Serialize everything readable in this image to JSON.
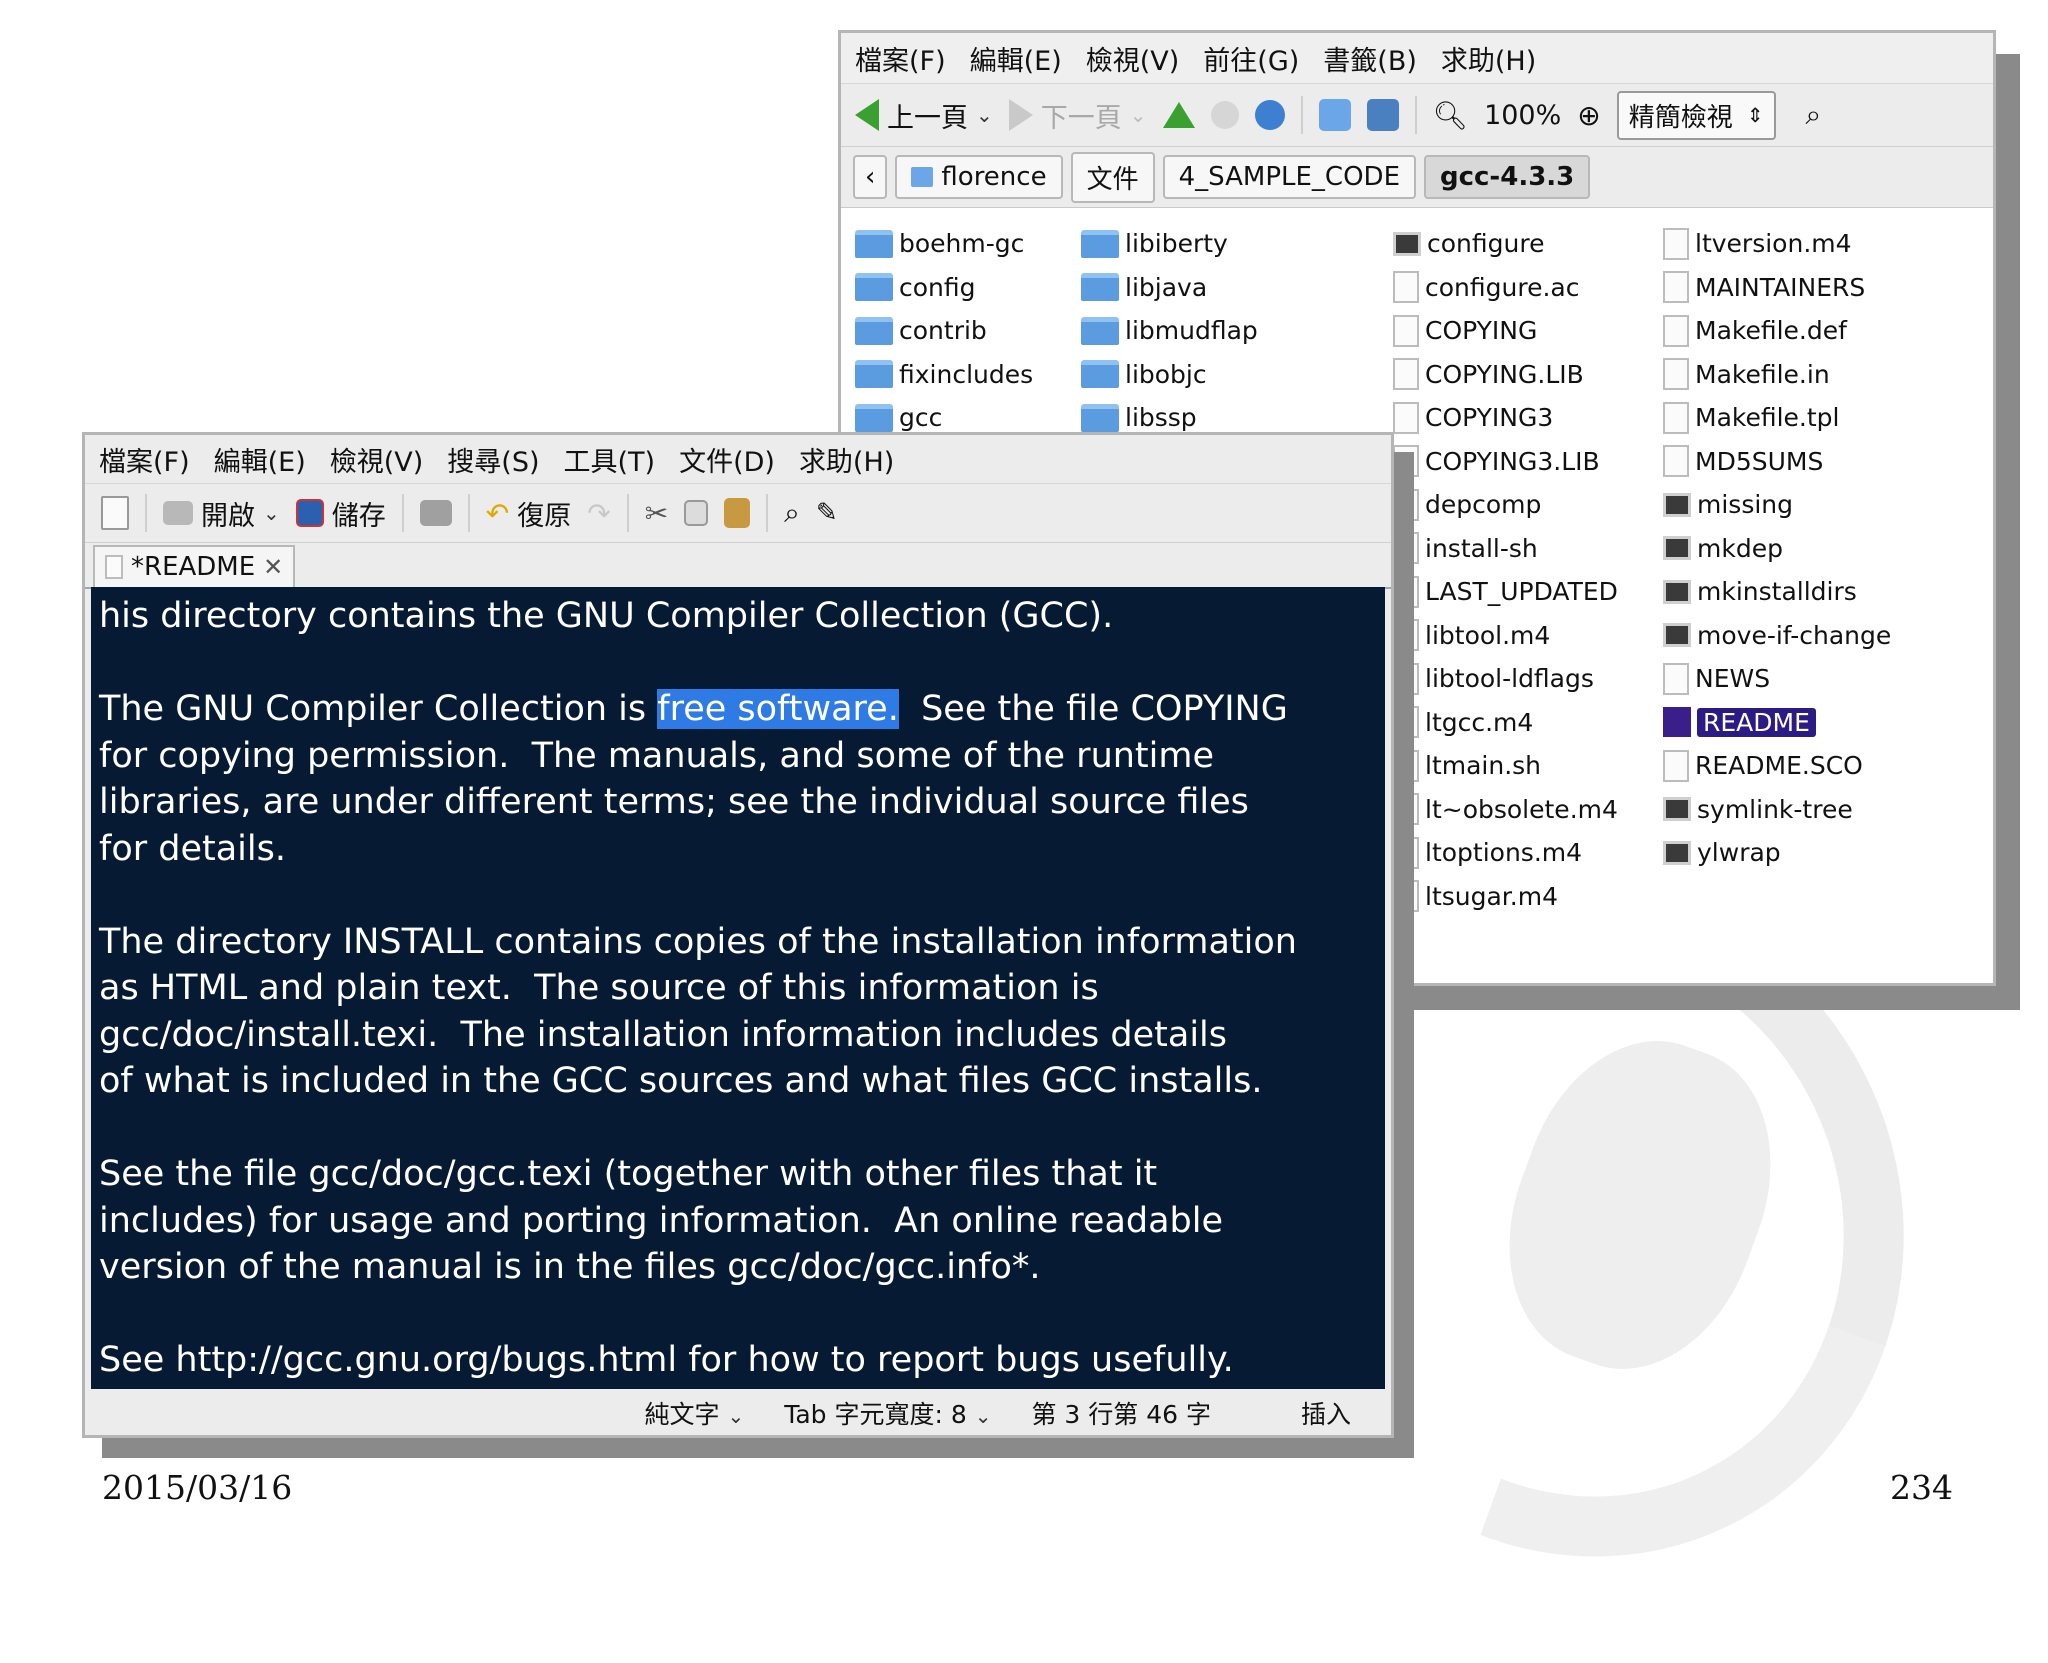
{
  "file_manager": {
    "menu": [
      "檔案(F)",
      "編輯(E)",
      "檢視(V)",
      "前往(G)",
      "書籤(B)",
      "求助(H)"
    ],
    "toolbar": {
      "back_label": "上一頁",
      "forward_label": "下一頁",
      "zoom_level": "100%",
      "view_mode": "精簡檢視"
    },
    "breadcrumb": [
      "florence",
      "文件",
      "4_SAMPLE_CODE",
      "gcc-4.3.3"
    ],
    "columns": [
      [
        {
          "name": "boehm-gc",
          "icon": "folder-icon"
        },
        {
          "name": "config",
          "icon": "folder-icon"
        },
        {
          "name": "contrib",
          "icon": "folder-icon"
        },
        {
          "name": "fixincludes",
          "icon": "folder-icon"
        },
        {
          "name": "gcc",
          "icon": "folder-icon"
        }
      ],
      [
        {
          "name": "libiberty",
          "icon": "folder-icon"
        },
        {
          "name": "libjava",
          "icon": "folder-icon"
        },
        {
          "name": "libmudflap",
          "icon": "folder-icon"
        },
        {
          "name": "libobjc",
          "icon": "folder-icon"
        },
        {
          "name": "libssp",
          "icon": "folder-icon"
        }
      ],
      [
        {
          "name": "configure",
          "icon": "script-icon"
        },
        {
          "name": "configure.ac",
          "icon": "document-icon"
        },
        {
          "name": "COPYING",
          "icon": "document-icon"
        },
        {
          "name": "COPYING.LIB",
          "icon": "document-icon"
        },
        {
          "name": "COPYING3",
          "icon": "document-icon"
        },
        {
          "name": "COPYING3.LIB",
          "icon": "document-icon"
        },
        {
          "name": "depcomp",
          "icon": "document-icon"
        },
        {
          "name": "install-sh",
          "icon": "document-icon"
        },
        {
          "name": "LAST_UPDATED",
          "icon": "document-icon"
        },
        {
          "name": "libtool.m4",
          "icon": "document-icon"
        },
        {
          "name": "libtool-ldflags",
          "icon": "document-icon"
        },
        {
          "name": "ltgcc.m4",
          "icon": "document-icon"
        },
        {
          "name": "ltmain.sh",
          "icon": "document-icon"
        },
        {
          "name": "lt~obsolete.m4",
          "icon": "document-icon"
        },
        {
          "name": "ltoptions.m4",
          "icon": "document-icon"
        },
        {
          "name": "ltsugar.m4",
          "icon": "document-icon"
        }
      ],
      [
        {
          "name": "ltversion.m4",
          "icon": "document-icon"
        },
        {
          "name": "MAINTAINERS",
          "icon": "document-icon"
        },
        {
          "name": "Makefile.def",
          "icon": "document-icon"
        },
        {
          "name": "Makefile.in",
          "icon": "document-icon"
        },
        {
          "name": "Makefile.tpl",
          "icon": "document-icon"
        },
        {
          "name": "MD5SUMS",
          "icon": "document-icon"
        },
        {
          "name": "missing",
          "icon": "script-icon"
        },
        {
          "name": "mkdep",
          "icon": "script-icon"
        },
        {
          "name": "mkinstalldirs",
          "icon": "script-icon"
        },
        {
          "name": "move-if-change",
          "icon": "script-icon"
        },
        {
          "name": "NEWS",
          "icon": "document-icon"
        },
        {
          "name": "README",
          "icon": "document-icon",
          "selected": true
        },
        {
          "name": "README.SCO",
          "icon": "document-icon"
        },
        {
          "name": "symlink-tree",
          "icon": "script-icon"
        },
        {
          "name": "ylwrap",
          "icon": "script-icon"
        }
      ]
    ]
  },
  "editor": {
    "menu": [
      "檔案(F)",
      "編輯(E)",
      "檢視(V)",
      "搜尋(S)",
      "工具(T)",
      "文件(D)",
      "求助(H)"
    ],
    "toolbar": {
      "open_label": "開啟",
      "save_label": "儲存",
      "undo_label": "復原"
    },
    "tab_title": "*README",
    "lines": [
      "his directory contains the GNU Compiler Collection (GCC).",
      "",
      "The GNU Compiler Collection is |free software.|  See the file COPYING",
      "for copying permission.  The manuals, and some of the runtime",
      "libraries, are under different terms; see the individual source files",
      "for details.",
      "",
      "The directory INSTALL contains copies of the installation information",
      "as HTML and plain text.  The source of this information is",
      "gcc/doc/install.texi.  The installation information includes details",
      "of what is included in the GCC sources and what files GCC installs.",
      "",
      "See the file gcc/doc/gcc.texi (together with other files that it",
      "includes) for usage and porting information.  An online readable",
      "version of the manual is in the files gcc/doc/gcc.info*.",
      "",
      "See http://gcc.gnu.org/bugs.html for how to report bugs usefully."
    ],
    "status": {
      "syntax": "純文字",
      "tab_width": "Tab 字元寬度: 8",
      "position": "第 3 行第 46 字",
      "mode": "插入"
    }
  },
  "slide": {
    "date": "2015/03/16",
    "page": "234"
  }
}
